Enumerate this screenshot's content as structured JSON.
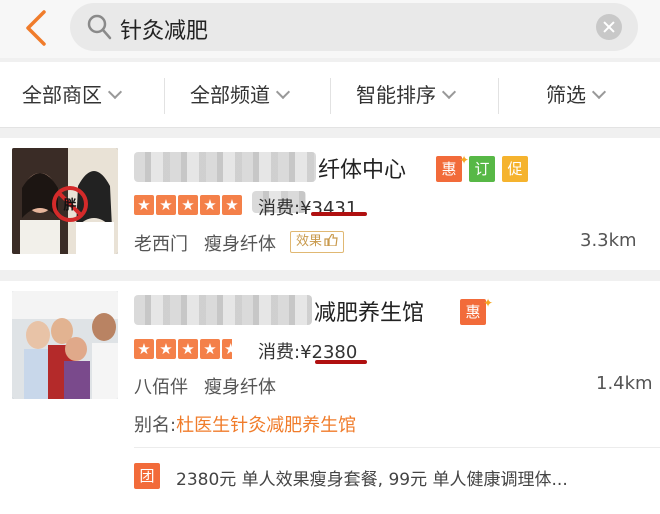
{
  "search": {
    "query": "针灸减肥"
  },
  "filters": [
    {
      "label": "全部商区"
    },
    {
      "label": "全部频道"
    },
    {
      "label": "智能排序"
    },
    {
      "label": "筛选"
    }
  ],
  "results": [
    {
      "name_visible": "纤体中心",
      "badges": [
        "惠",
        "订",
        "促"
      ],
      "rating": 5,
      "price_label": "消费:",
      "currency": "¥",
      "price": "3431",
      "area": "老西门",
      "category": "瘦身纤体",
      "tag": "效果",
      "distance": "3.3km"
    },
    {
      "name_visible": "减肥养生馆",
      "badges": [
        "惠"
      ],
      "rating": 4.5,
      "price_label": "消费:",
      "currency": "¥",
      "price": "2380",
      "area": "八佰伴",
      "category": "瘦身纤体",
      "distance": "1.4km",
      "alias_label": "别名:",
      "alias": "杜医生针灸减肥养生馆",
      "deal_icon": "团",
      "deal": "2380元 单人效果瘦身套餐, 99元 单人健康调理体..."
    }
  ],
  "colors": {
    "accent_orange": "#f48049",
    "badge_hui": "#f26b3a",
    "badge_ding": "#57b846",
    "badge_cu": "#f5b32e",
    "alias_orange": "#f07c2b",
    "underline_red": "#b01010",
    "back_arrow": "#f07c2b"
  }
}
